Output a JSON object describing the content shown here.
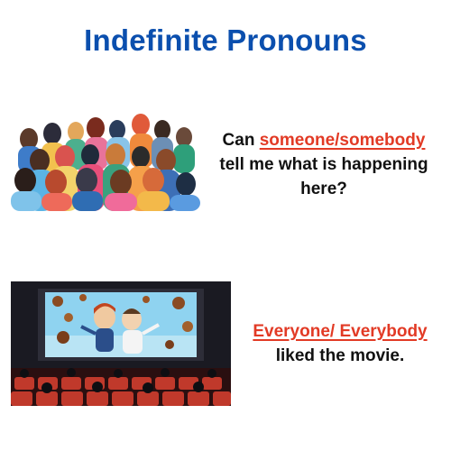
{
  "title": "Indefinite Pronouns",
  "example1": {
    "prefix": "Can ",
    "highlight": "someone/somebody ",
    "line2": "tell me what is happening",
    "line3": "here?"
  },
  "example2": {
    "highlight": "Everyone/ Everybody ",
    "line2": "liked the movie."
  },
  "colors": {
    "title": "#0b4fae",
    "highlight": "#e23a25",
    "text": "#111111"
  }
}
